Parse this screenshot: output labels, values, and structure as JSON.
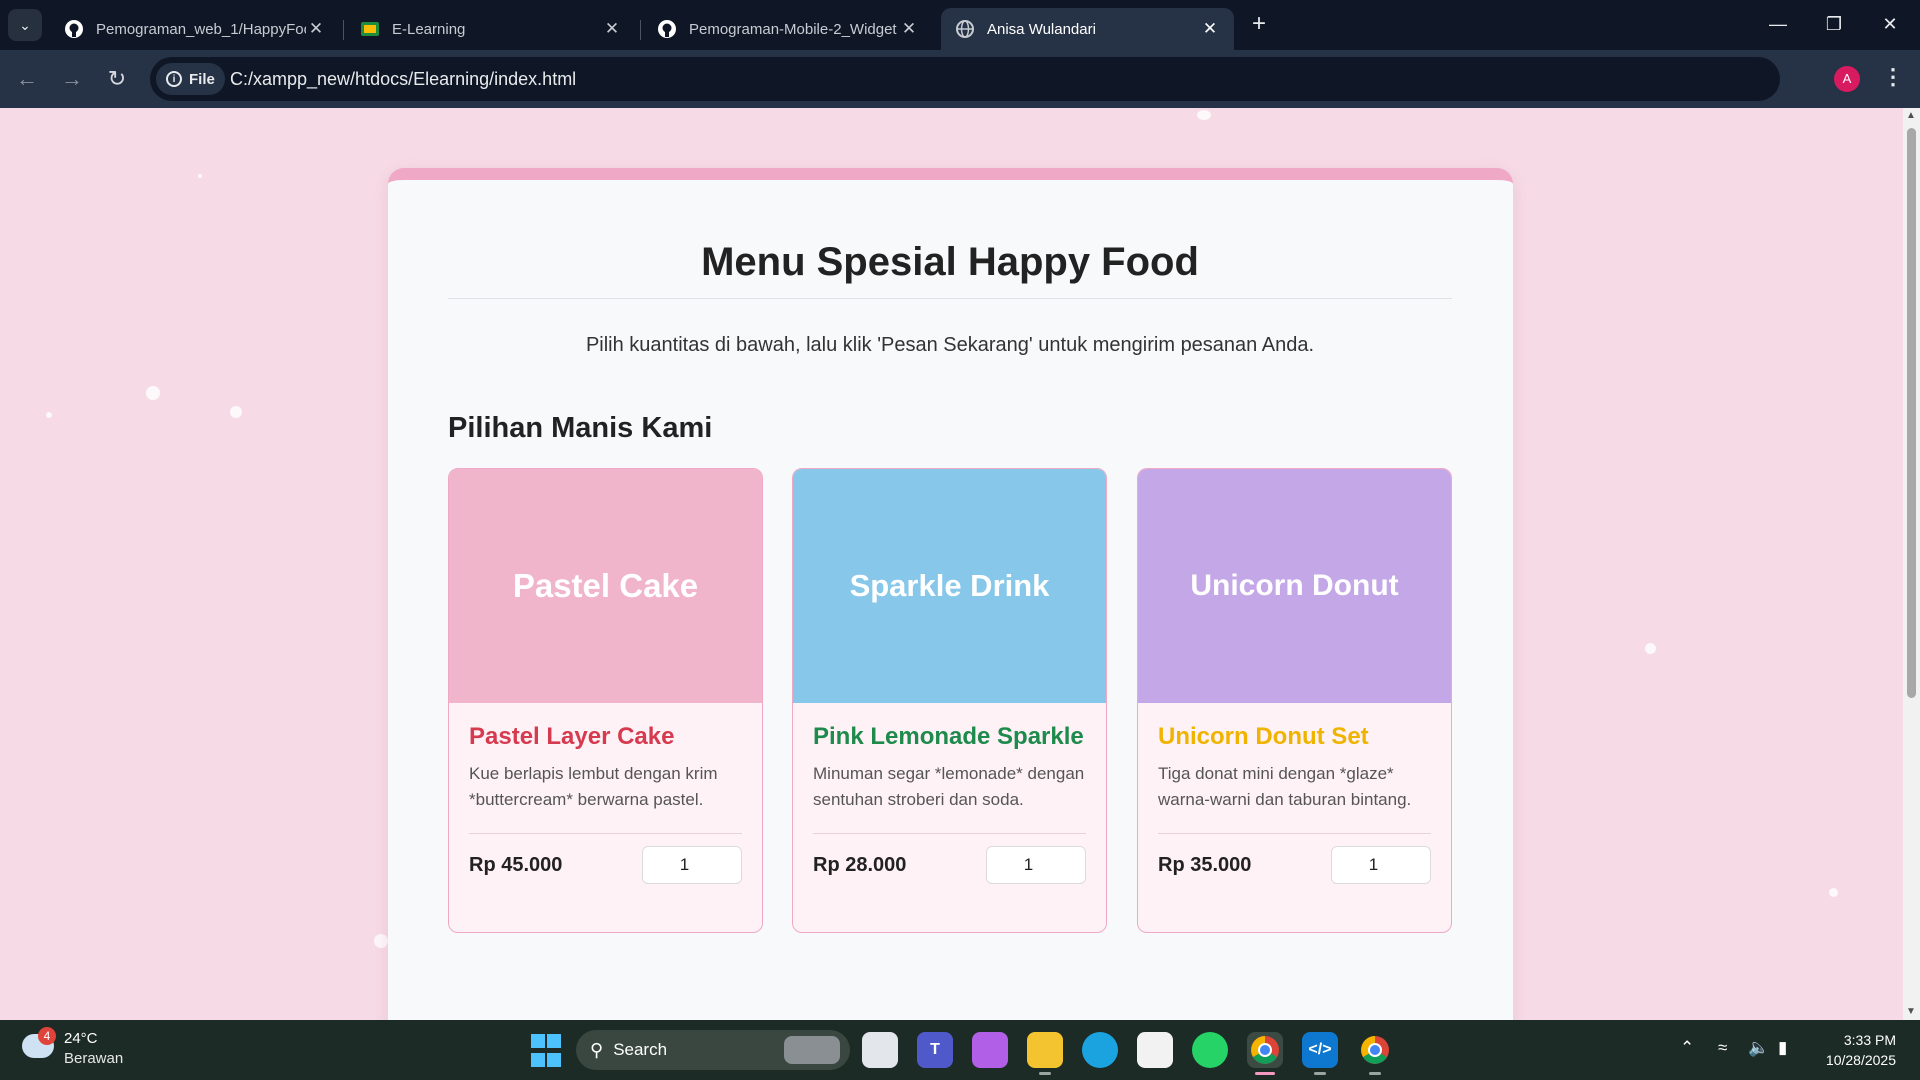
{
  "browser": {
    "tabs": [
      {
        "title": "Pemograman_web_1/HappyFoo",
        "icon": "github-icon"
      },
      {
        "title": "E-Learning",
        "icon": "classroom-icon"
      },
      {
        "title": "Pemograman-Mobile-2_Widget",
        "icon": "github-icon"
      },
      {
        "title": "Anisa Wulandari",
        "icon": "globe-icon"
      }
    ],
    "site_chip": "File",
    "url": "C:/xampp_new/htdocs/Elearning/index.html",
    "profile_initial": "A"
  },
  "page": {
    "title": "Menu Spesial Happy Food",
    "intro": "Pilih kuantitas di bawah, lalu klik 'Pesan Sekarang' untuk mengirim pesanan Anda.",
    "section_title": "Pilihan Manis Kami",
    "items": [
      {
        "image_label": "Pastel Cake",
        "image_color": "#f0b5cb",
        "name": "Pastel Layer Cake",
        "name_color": "#d63a4f",
        "description": "Kue berlapis lembut dengan krim *buttercream* berwarna pastel.",
        "price": "Rp 45.000",
        "quantity": "1"
      },
      {
        "image_label": "Sparkle Drink",
        "image_color": "#87c8ea",
        "name": "Pink Lemonade Sparkle",
        "name_color": "#1e8a4c",
        "description": "Minuman segar *lemonade* dengan sentuhan stroberi dan soda.",
        "price": "Rp 28.000",
        "quantity": "1"
      },
      {
        "image_label": "Unicorn Donut",
        "image_color": "#c4a7e7",
        "name": "Unicorn Donut Set",
        "name_color": "#f0b400",
        "description": "Tiga donat mini dengan *glaze* warna-warni dan taburan bintang.",
        "price": "Rp 35.000",
        "quantity": "1"
      }
    ]
  },
  "taskbar": {
    "weather": {
      "temp": "24°C",
      "condition": "Berawan",
      "badge": "4"
    },
    "search_label": "Search",
    "time": "3:33 PM",
    "date": "10/28/2025"
  },
  "colors": {
    "accent": "#efa9c6",
    "page_bg": "#f6dbe6"
  }
}
